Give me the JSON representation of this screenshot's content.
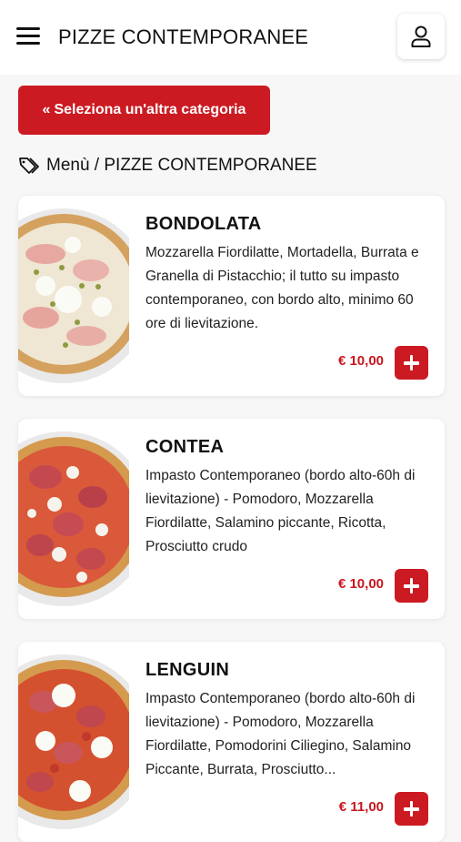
{
  "header": {
    "title": "PIZZE CONTEMPORANEE"
  },
  "category_button": {
    "label": "Seleziona un'altra categoria"
  },
  "breadcrumb": {
    "text": "Menù / PIZZE CONTEMPORANEE"
  },
  "products": [
    {
      "name": "BONDOLATA",
      "description": "Mozzarella Fiordilatte, Mortadella, Burrata e Granella di Pistacchio; il tutto su impasto contemporaneo, con bordo alto, minimo 60 ore di lievitazione.",
      "price": "€ 10,00"
    },
    {
      "name": "CONTEA",
      "description": "Impasto Contemporaneo (bordo alto-60h di lievitazione) - Pomodoro, Mozzarella Fiordilatte, Salamino piccante, Ricotta, Prosciutto crudo",
      "price": "€ 10,00"
    },
    {
      "name": "LENGUIN",
      "description": "Impasto Contemporaneo (bordo alto-60h di lievitazione) - Pomodoro, Mozzarella Fiordilatte, Pomodorini Ciliegino, Salamino Piccante, Burrata, Prosciutto...",
      "price": "€ 11,00"
    }
  ],
  "colors": {
    "accent": "#cc1a22",
    "price": "#c8161e"
  }
}
